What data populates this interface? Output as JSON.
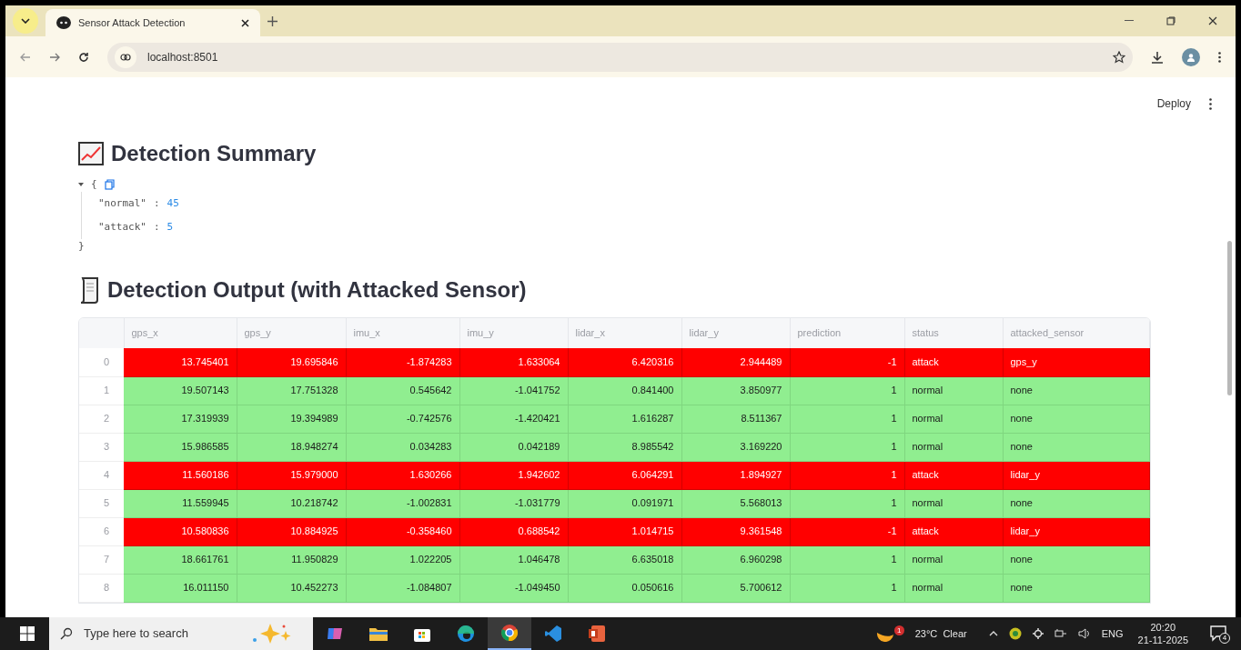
{
  "browser": {
    "tab_title": "Sensor Attack Detection",
    "url": "localhost:8501"
  },
  "app_toolbar": {
    "deploy": "Deploy"
  },
  "summary": {
    "title": "Detection Summary",
    "open_brace": "{",
    "close_brace": "}",
    "entries": [
      {
        "key": "\"normal\"",
        "separator": ":",
        "value": "45"
      },
      {
        "key": "\"attack\"",
        "separator": ":",
        "value": "5"
      }
    ]
  },
  "output": {
    "title": "Detection Output (with Attacked Sensor)",
    "table": {
      "columns": [
        "gps_x",
        "gps_y",
        "imu_x",
        "imu_y",
        "lidar_x",
        "lidar_y",
        "prediction",
        "status",
        "attacked_sensor"
      ],
      "rows": [
        {
          "kind": "attack",
          "index": "0",
          "cells": [
            "13.745401",
            "19.695846",
            "-1.874283",
            "1.633064",
            "6.420316",
            "2.944489",
            "-1",
            "attack",
            "gps_y"
          ]
        },
        {
          "kind": "normal",
          "index": "1",
          "cells": [
            "19.507143",
            "17.751328",
            "0.545642",
            "-1.041752",
            "0.841400",
            "3.850977",
            "1",
            "normal",
            "none"
          ]
        },
        {
          "kind": "normal",
          "index": "2",
          "cells": [
            "17.319939",
            "19.394989",
            "-0.742576",
            "-1.420421",
            "1.616287",
            "8.511367",
            "1",
            "normal",
            "none"
          ]
        },
        {
          "kind": "normal",
          "index": "3",
          "cells": [
            "15.986585",
            "18.948274",
            "0.034283",
            "0.042189",
            "8.985542",
            "3.169220",
            "1",
            "normal",
            "none"
          ]
        },
        {
          "kind": "attack",
          "index": "4",
          "cells": [
            "11.560186",
            "15.979000",
            "1.630266",
            "1.942602",
            "6.064291",
            "1.894927",
            "1",
            "attack",
            "lidar_y"
          ]
        },
        {
          "kind": "normal",
          "index": "5",
          "cells": [
            "11.559945",
            "10.218742",
            "-1.002831",
            "-1.031779",
            "0.091971",
            "5.568013",
            "1",
            "normal",
            "none"
          ]
        },
        {
          "kind": "attack",
          "index": "6",
          "cells": [
            "10.580836",
            "10.884925",
            "-0.358460",
            "0.688542",
            "1.014715",
            "9.361548",
            "-1",
            "attack",
            "lidar_y"
          ]
        },
        {
          "kind": "normal",
          "index": "7",
          "cells": [
            "18.661761",
            "11.950829",
            "1.022205",
            "1.046478",
            "6.635018",
            "6.960298",
            "1",
            "normal",
            "none"
          ]
        },
        {
          "kind": "normal",
          "index": "8",
          "cells": [
            "16.011150",
            "10.452273",
            "-1.084807",
            "-1.049450",
            "0.050616",
            "5.700612",
            "1",
            "normal",
            "none"
          ]
        }
      ]
    }
  },
  "taskbar": {
    "search_placeholder": "Type here to search",
    "weather": "23°C  Clear",
    "weather_badge": "1",
    "language": "ENG",
    "time": "20:20",
    "date": "21-11-2025",
    "notifications": "4"
  }
}
